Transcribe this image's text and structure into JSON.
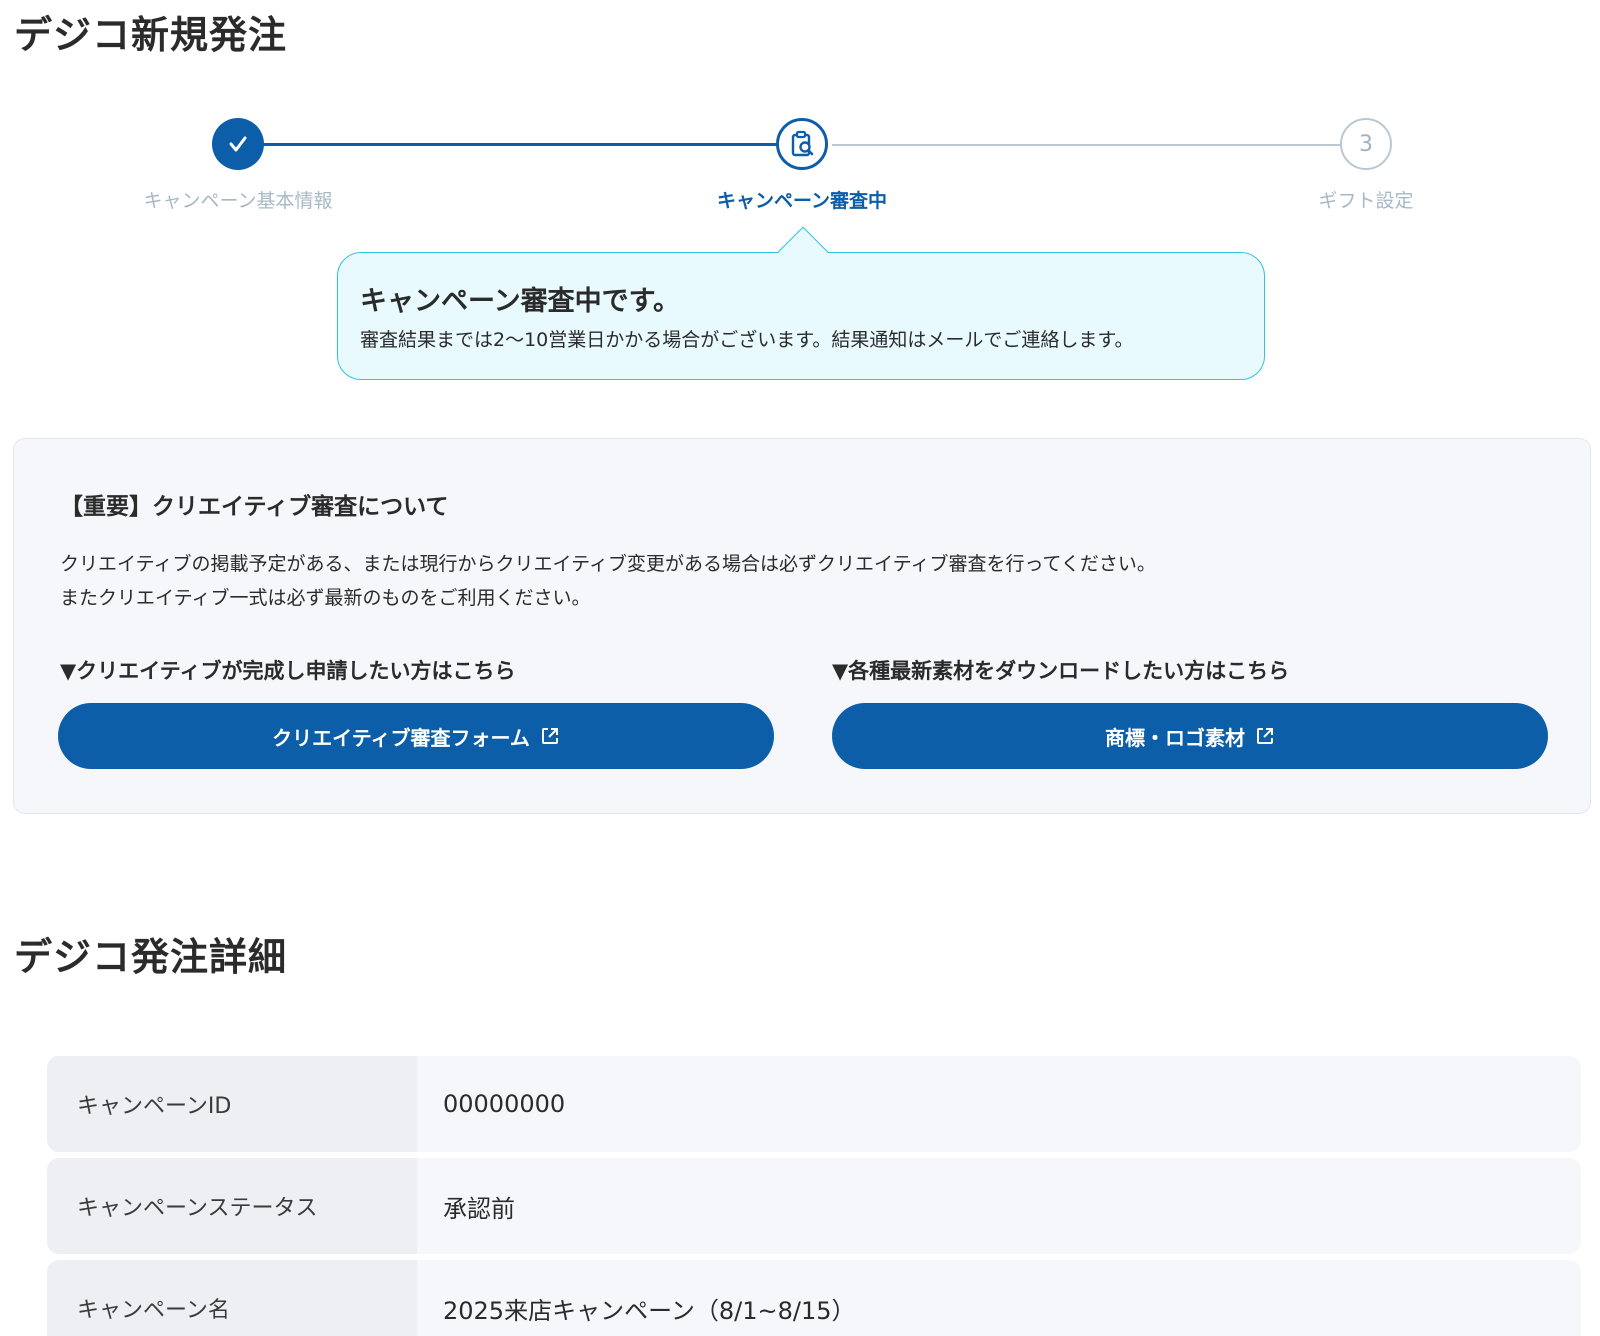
{
  "page_title": "デジコ新規発注",
  "stepper": {
    "steps": [
      {
        "label": "キャンペーン基本情報",
        "state": "done",
        "icon": "check-icon"
      },
      {
        "label": "キャンペーン審査中",
        "state": "current",
        "icon": "clipboard-search-icon"
      },
      {
        "label": "ギフト設定",
        "state": "todo",
        "number": "3"
      }
    ]
  },
  "callout": {
    "title": "キャンペーン審査中です。",
    "body": "審査結果までは2〜10営業日かかる場合がございます。結果通知はメールでご連絡します。"
  },
  "notice": {
    "title": "【重要】クリエイティブ審査について",
    "line1": "クリエイティブの掲載予定がある、または現行からクリエイティブ変更がある場合は必ずクリエイティブ審査を行ってください。",
    "line2": "またクリエイティブ一式は必ず最新のものをご利用ください。",
    "left_label": "▼クリエイティブが完成し申請したい方はこちら",
    "right_label": "▼各種最新素材をダウンロードしたい方はこちら",
    "left_button": "クリエイティブ審査フォーム",
    "right_button": "商標・ロゴ素材",
    "button_icon": "external-link-icon"
  },
  "details": {
    "title": "デジコ発注詳細",
    "rows": [
      {
        "key": "キャンペーンID",
        "value": "00000000"
      },
      {
        "key": "キャンペーンステータス",
        "value": "承認前"
      },
      {
        "key": "キャンペーン名",
        "value": "2025来店キャンペーン（8/1~8/15）"
      }
    ]
  },
  "colors": {
    "primary": "#0d5ea8",
    "callout_border": "#2ec4e0",
    "callout_bg": "#e8fafd",
    "inactive": "#a7b9c6"
  }
}
